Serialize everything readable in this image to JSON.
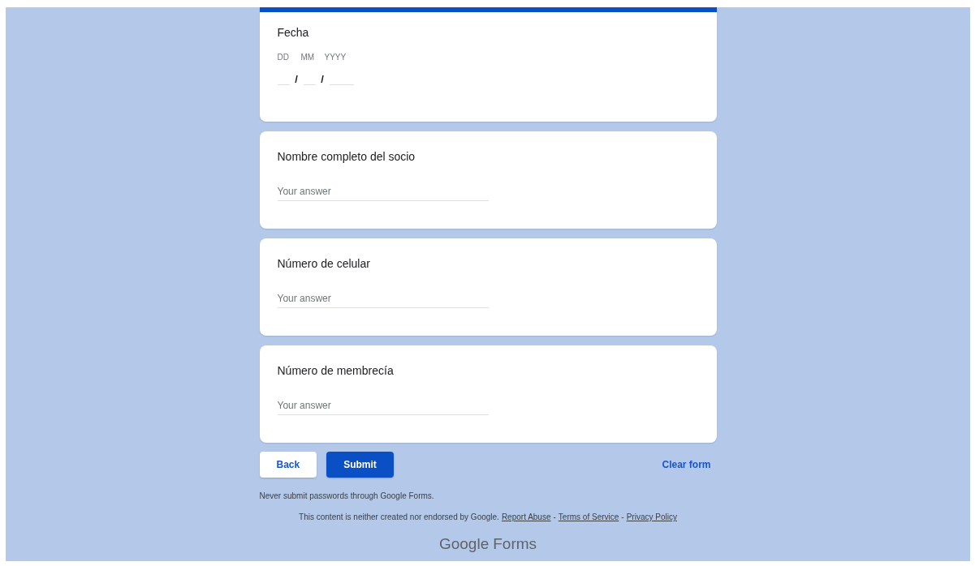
{
  "date_question": {
    "title": "Fecha",
    "parts": [
      {
        "label": "DD"
      },
      {
        "label": "MM"
      },
      {
        "label": "YYYY"
      }
    ],
    "separator": "/"
  },
  "questions": [
    {
      "title": "Nombre completo del socio",
      "placeholder": "Your answer"
    },
    {
      "title": "Número de celular",
      "placeholder": "Your answer"
    },
    {
      "title": "Número de membrecía",
      "placeholder": "Your answer"
    }
  ],
  "buttons": {
    "back": "Back",
    "submit": "Submit",
    "clear": "Clear form"
  },
  "warning": "Never submit passwords through Google Forms.",
  "disclaimer": {
    "text": "This content is neither created nor endorsed by Google.",
    "links": [
      "Report Abuse",
      "Terms of Service",
      "Privacy Policy"
    ],
    "separator": "-"
  },
  "brand": {
    "google": "Google",
    "forms": "Forms"
  }
}
